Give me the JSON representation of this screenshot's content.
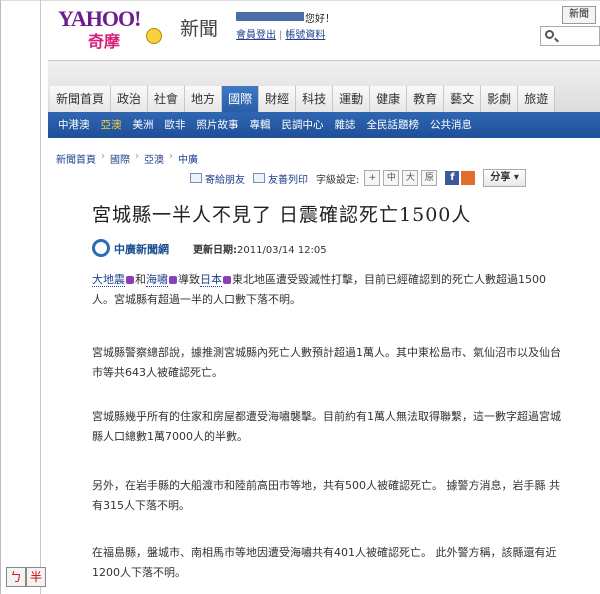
{
  "header": {
    "logo_primary": "YAHOO!",
    "logo_secondary": "奇摩",
    "section_name": "新聞",
    "greeting": "您好！",
    "links": [
      "會員登出",
      "帳號資料"
    ],
    "news_button": "新聞"
  },
  "tabs": [
    {
      "label": "新聞首頁",
      "active": false
    },
    {
      "label": "政治",
      "active": false
    },
    {
      "label": "社會",
      "active": false
    },
    {
      "label": "地方",
      "active": false
    },
    {
      "label": "國際",
      "active": true
    },
    {
      "label": "財經",
      "active": false
    },
    {
      "label": "科技",
      "active": false
    },
    {
      "label": "運動",
      "active": false
    },
    {
      "label": "健康",
      "active": false
    },
    {
      "label": "教育",
      "active": false
    },
    {
      "label": "藝文",
      "active": false
    },
    {
      "label": "影劇",
      "active": false
    },
    {
      "label": "旅遊",
      "active": false
    }
  ],
  "subnav": [
    {
      "label": "中港澳",
      "active": false
    },
    {
      "label": "亞澳",
      "active": true
    },
    {
      "label": "美洲",
      "active": false
    },
    {
      "label": "歐非",
      "active": false
    },
    {
      "label": "照片故事",
      "active": false
    },
    {
      "label": "專輯",
      "active": false
    },
    {
      "label": "民調中心",
      "active": false
    },
    {
      "label": "雜誌",
      "active": false
    },
    {
      "label": "全民話題榜",
      "active": false
    },
    {
      "label": "公共消息",
      "active": false
    }
  ],
  "breadcrumb": [
    "新聞首頁",
    "國際",
    "亞澳",
    "中廣"
  ],
  "toolbar": {
    "mail_friend": "寄給朋友",
    "print": "友善列印",
    "font_size_label": "字級設定:",
    "font_buttons": [
      "+",
      "中",
      "大",
      "原"
    ],
    "share": "分享"
  },
  "article": {
    "headline": "宮城縣一半人不見了 日震確認死亡1500人",
    "source": "中廣新聞網",
    "updated_label": "更新日期:",
    "updated_value": "2011/03/14 12:05",
    "p1": {
      "kw1": "大地震",
      "mid1": "和",
      "kw2": "海嘯",
      "mid2": "導致",
      "kw3": "日本",
      "rest": "東北地區遭受毀滅性打擊，目前已經確認到的死亡人數超過1500人。宮城縣有超過一半的人口數下落不明。"
    },
    "p2": "宮城縣警察總部說，據推測宮城縣內死亡人數預計超過1萬人。其中東松島市、氣仙沼市以及仙台市等共643人被確認死亡。",
    "p3": "宮城縣幾乎所有的住家和房屋都遭受海嘯襲擊。目前約有1萬人無法取得聯繫，這一數字超過宮城縣人口總數1萬7000人的半數。",
    "p4": "另外，在岩手縣的大船渡市和陸前高田市等地，共有500人被確認死亡。 據警方消息，岩手縣 共有315人下落不明。",
    "p5": "在福島縣，盤城市、南相馬市等地因遭受海嘯共有401人被確認死亡。 此外警方稱，該縣還有近1200人下落不明。"
  },
  "ime": [
    "ㄅ",
    "半"
  ]
}
